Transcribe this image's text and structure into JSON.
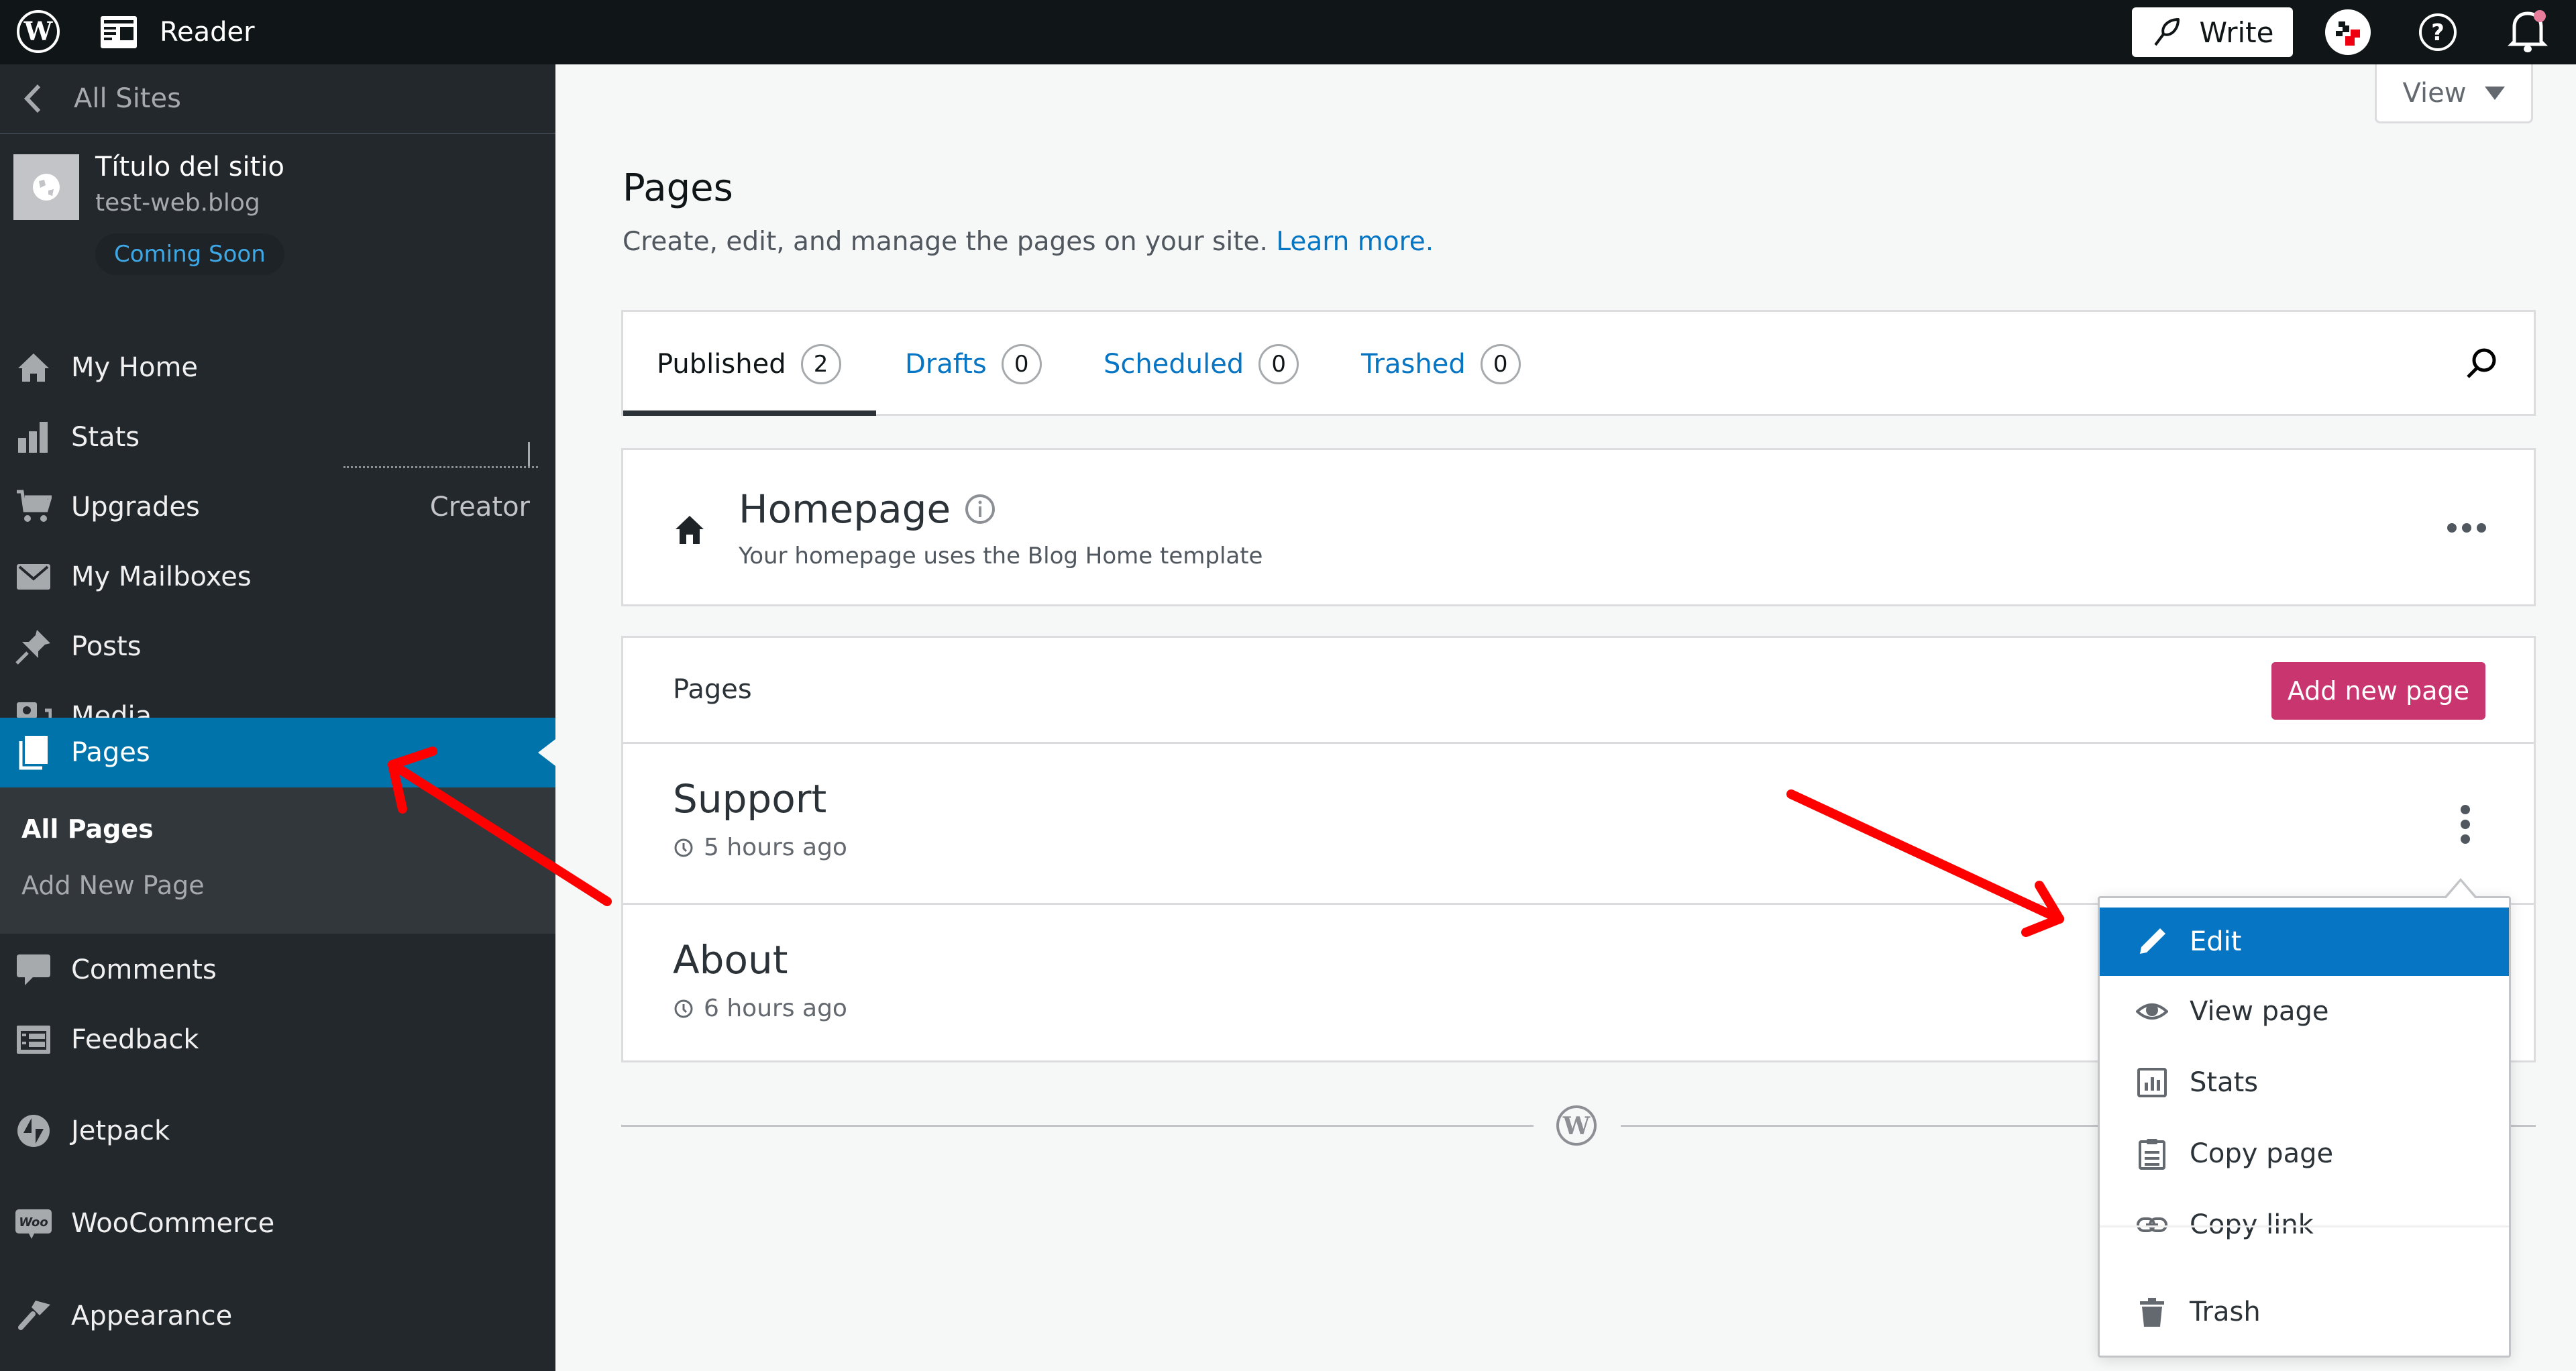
{
  "topbar": {
    "reader_label": "Reader",
    "write_label": "Write",
    "icons": [
      "wordpress-logo-icon",
      "reader-icon",
      "feather-icon",
      "avatar",
      "help-icon",
      "bell-icon"
    ]
  },
  "sidebar": {
    "all_sites_label": "All Sites",
    "site": {
      "title": "Título del sitio",
      "url": "test-web.blog",
      "status_badge": "Coming Soon"
    },
    "items": [
      {
        "label": "My Home",
        "icon": "home-icon"
      },
      {
        "label": "Stats",
        "icon": "stats-icon"
      },
      {
        "label": "Upgrades",
        "icon": "cart-icon",
        "badge": "Creator"
      },
      {
        "label": "My Mailboxes",
        "icon": "mail-icon"
      },
      {
        "label": "Posts",
        "icon": "pin-icon"
      },
      {
        "label": "Media",
        "icon": "media-icon"
      },
      {
        "label": "Pages",
        "icon": "pages-icon",
        "active": true
      },
      {
        "label": "Comments",
        "icon": "comment-icon"
      },
      {
        "label": "Feedback",
        "icon": "feedback-icon"
      },
      {
        "label": "Jetpack",
        "icon": "jetpack-icon"
      },
      {
        "label": "WooCommerce",
        "icon": "woo-icon"
      },
      {
        "label": "Appearance",
        "icon": "brush-icon"
      }
    ],
    "submenu": [
      {
        "label": "All Pages",
        "current": true
      },
      {
        "label": "Add New Page"
      }
    ]
  },
  "main": {
    "view_label": "View",
    "title": "Pages",
    "subtitle": "Create, edit, and manage the pages on your site.",
    "learn_more": "Learn more.",
    "tabs": [
      {
        "label": "Published",
        "count": "2",
        "selected": true
      },
      {
        "label": "Drafts",
        "count": "0"
      },
      {
        "label": "Scheduled",
        "count": "0"
      },
      {
        "label": "Trashed",
        "count": "0"
      }
    ],
    "homepage": {
      "title": "Homepage",
      "description": "Your homepage uses the Blog Home template"
    },
    "list": {
      "header": "Pages",
      "add_button": "Add new page",
      "rows": [
        {
          "title": "Support",
          "time": "5 hours ago"
        },
        {
          "title": "About",
          "time": "6 hours ago"
        }
      ]
    }
  },
  "popover_menu": {
    "items": [
      {
        "label": "Edit",
        "icon": "pencil-icon",
        "highlighted": true
      },
      {
        "label": "View page",
        "icon": "eye-icon"
      },
      {
        "label": "Stats",
        "icon": "stats-box-icon"
      },
      {
        "label": "Copy page",
        "icon": "clipboard-icon"
      },
      {
        "label": "Copy link",
        "icon": "link-icon"
      },
      {
        "label": "Trash",
        "icon": "trash-icon"
      }
    ]
  },
  "colors": {
    "topbar_bg": "#101517",
    "sidebar_bg": "#23282d",
    "active_nav": "#0073aa",
    "link_blue": "#0675c4",
    "add_button": "#c9356e",
    "annotation_arrow": "#ff0000"
  }
}
